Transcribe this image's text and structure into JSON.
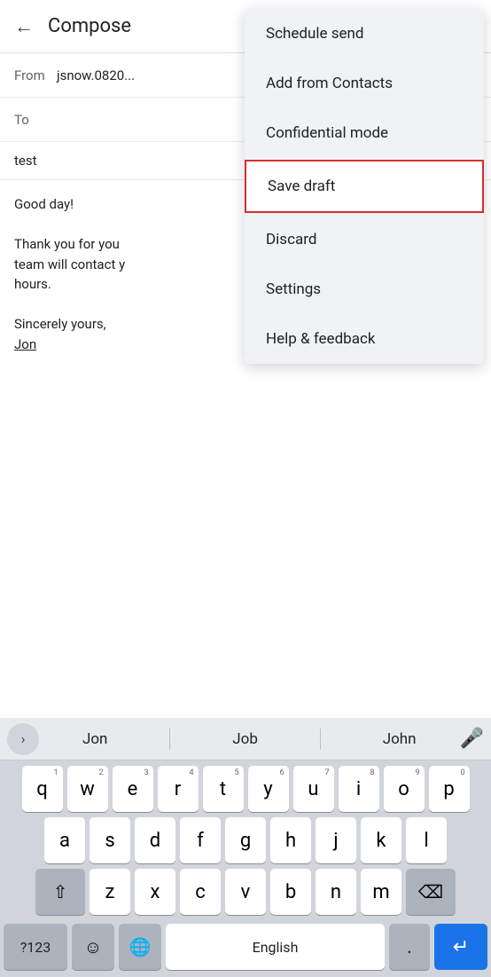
{
  "header": {
    "back_label": "←",
    "title": "Compose"
  },
  "fields": {
    "from_label": "From",
    "from_value": "jsnow.0820...",
    "to_label": "To",
    "to_value": "",
    "subject_value": "test"
  },
  "email_body": {
    "greeting": "Good day!",
    "body": "Thank you for you\nteam will contact y\nhours.",
    "sign_off": "Sincerely yours,",
    "signature": "Jon"
  },
  "dropdown": {
    "items": [
      {
        "id": "schedule-send",
        "label": "Schedule send",
        "highlighted": false
      },
      {
        "id": "add-contacts",
        "label": "Add from Contacts",
        "highlighted": false
      },
      {
        "id": "confidential-mode",
        "label": "Confidential mode",
        "highlighted": false
      },
      {
        "id": "save-draft",
        "label": "Save draft",
        "highlighted": true
      },
      {
        "id": "discard",
        "label": "Discard",
        "highlighted": false
      },
      {
        "id": "settings",
        "label": "Settings",
        "highlighted": false
      },
      {
        "id": "help-feedback",
        "label": "Help & feedback",
        "highlighted": false
      }
    ]
  },
  "keyboard": {
    "autocomplete": {
      "expand_icon": "›",
      "words": [
        "Jon",
        "Job",
        "John"
      ],
      "mic_icon": "🎤"
    },
    "rows": [
      [
        {
          "char": "q",
          "num": "1"
        },
        {
          "char": "w",
          "num": "2"
        },
        {
          "char": "e",
          "num": "3"
        },
        {
          "char": "r",
          "num": "4"
        },
        {
          "char": "t",
          "num": "5"
        },
        {
          "char": "y",
          "num": "6"
        },
        {
          "char": "u",
          "num": "7"
        },
        {
          "char": "i",
          "num": "8"
        },
        {
          "char": "o",
          "num": "9"
        },
        {
          "char": "p",
          "num": "0"
        }
      ],
      [
        {
          "char": "a"
        },
        {
          "char": "s"
        },
        {
          "char": "d"
        },
        {
          "char": "f"
        },
        {
          "char": "g"
        },
        {
          "char": "h"
        },
        {
          "char": "j"
        },
        {
          "char": "k"
        },
        {
          "char": "l"
        }
      ],
      [
        {
          "char": "z"
        },
        {
          "char": "x"
        },
        {
          "char": "c"
        },
        {
          "char": "v"
        },
        {
          "char": "b"
        },
        {
          "char": "n"
        },
        {
          "char": "m"
        }
      ]
    ],
    "shift_icon": "⇧",
    "backspace_icon": "⌫",
    "bottom": {
      "num_label": "?123",
      "emoji_icon": "☺",
      "globe_icon": "⊕",
      "space_label": "English",
      "period": ".",
      "enter_icon": "↵"
    }
  }
}
